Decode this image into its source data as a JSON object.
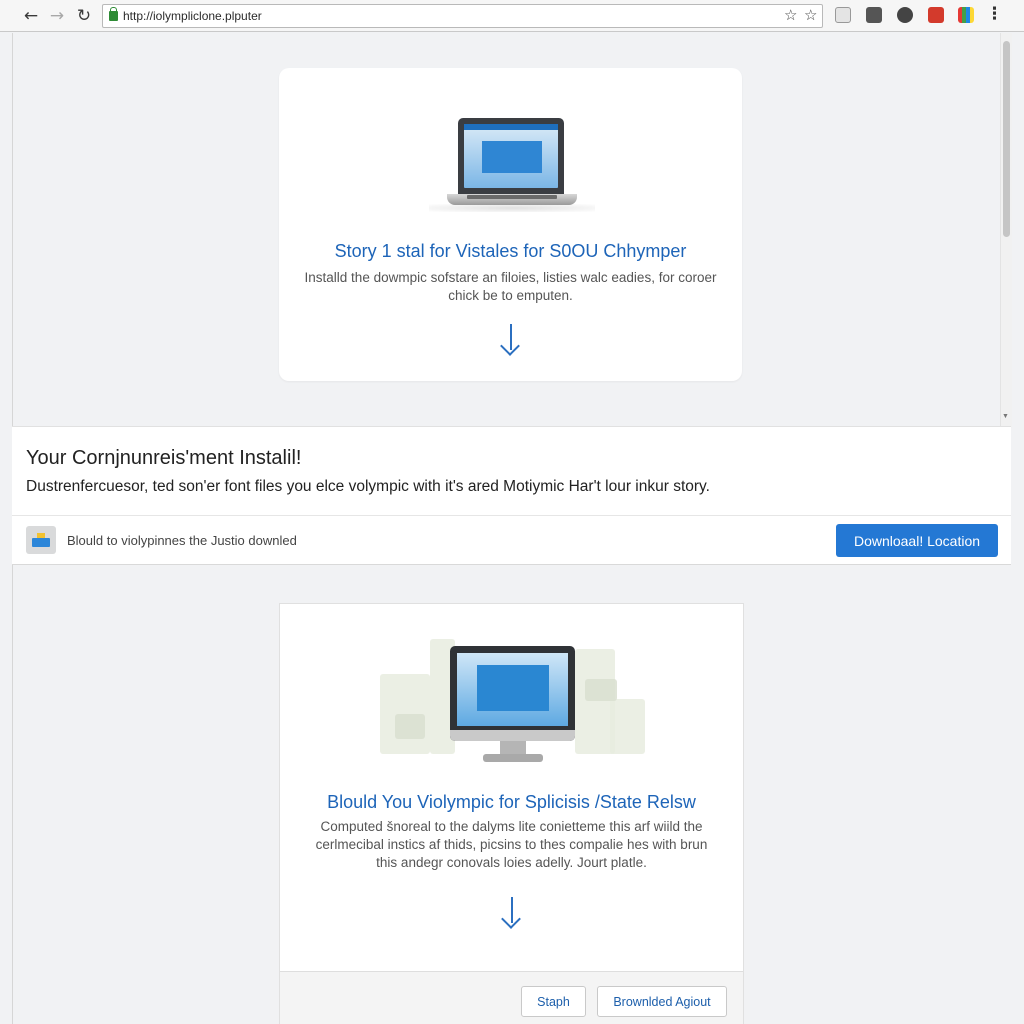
{
  "browser": {
    "url": "http://iolympliclone.plputer",
    "icons": {
      "back": "back-arrow-icon",
      "forward": "forward-arrow-icon",
      "reload": "reload-icon",
      "secure": "lock-icon",
      "star_outline": "star-outline-icon",
      "bookmark": "bookmark-star-icon",
      "menu": "kebab-menu-icon"
    },
    "extensions": [
      "page-icon",
      "save-icon",
      "account-icon",
      "pdf-icon",
      "apps-icon"
    ]
  },
  "card1": {
    "title": "Story 1 stal for Vistales for S0OU Chhymper",
    "description_line1": "Installd the dowmpic sofstare an filoies, listies walc eadies, for coroer",
    "description_line2": "chick be to emputen.",
    "icon": "download-arrow-icon"
  },
  "banner": {
    "title": "Your Cornjnunreis'ment Instalil!",
    "subtitle": "Dustrenfercuesor, ted son'er font files you elce volympic with it's ared Motiymic Har't lour inkur story.",
    "download_label": "Blould to violypinnes the Justio downled",
    "download_button": "Downloaal! Location"
  },
  "card2": {
    "title": "Blould You Violympic for Splicisis /State Relsw",
    "description_line1": "Computed šnoreal to the dalyms lite conietteme this arf wiild the",
    "description_line2": "cerlmecibal instics af thids, picsins to thes compalie hes with brun",
    "description_line3": "this andegr conovals loies adelly. Jourt platle.",
    "icon": "download-arrow-icon",
    "buttons": {
      "secondary": "Staph",
      "primary": "Brownlded Agiout"
    }
  },
  "colors": {
    "accent": "#2478d4",
    "link_text": "#1d64b8",
    "page_bg": "#f1f2f4",
    "secure_green": "#2e8b35"
  }
}
